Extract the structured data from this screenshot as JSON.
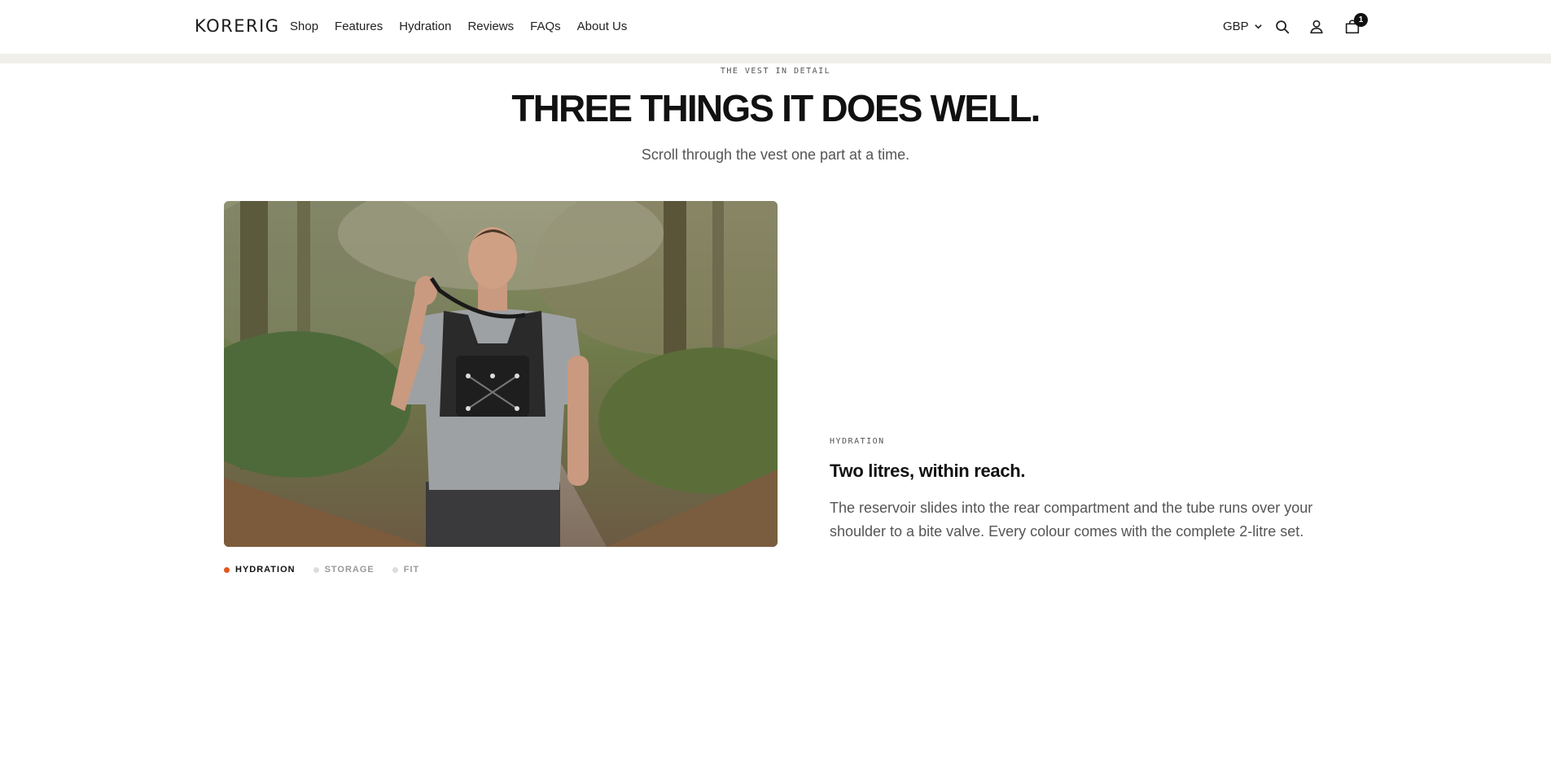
{
  "header": {
    "logo": "KORERIG",
    "nav": [
      "Shop",
      "Features",
      "Hydration",
      "Reviews",
      "FAQs",
      "About Us"
    ],
    "currency": "GBP",
    "cart_count": "1",
    "icons": [
      "chevron-down-icon",
      "search-icon",
      "account-icon",
      "cart-icon"
    ]
  },
  "section": {
    "eyebrow": "THE VEST IN DETAIL",
    "title": "THREE THINGS IT DOES WELL.",
    "subtitle": "Scroll through the vest one part at a time."
  },
  "tabs": [
    {
      "label": "HYDRATION",
      "active": true
    },
    {
      "label": "STORAGE",
      "active": false
    },
    {
      "label": "FIT",
      "active": false
    }
  ],
  "feature": {
    "eyebrow": "HYDRATION",
    "title": "Two litres, within reach.",
    "body": "The reservoir slides into the rear compartment and the tube runs over your shoulder to a bite valve. Every colour comes with the complete 2-litre set."
  },
  "colors": {
    "accent": "#e2561f",
    "strip": "#f1efea"
  }
}
